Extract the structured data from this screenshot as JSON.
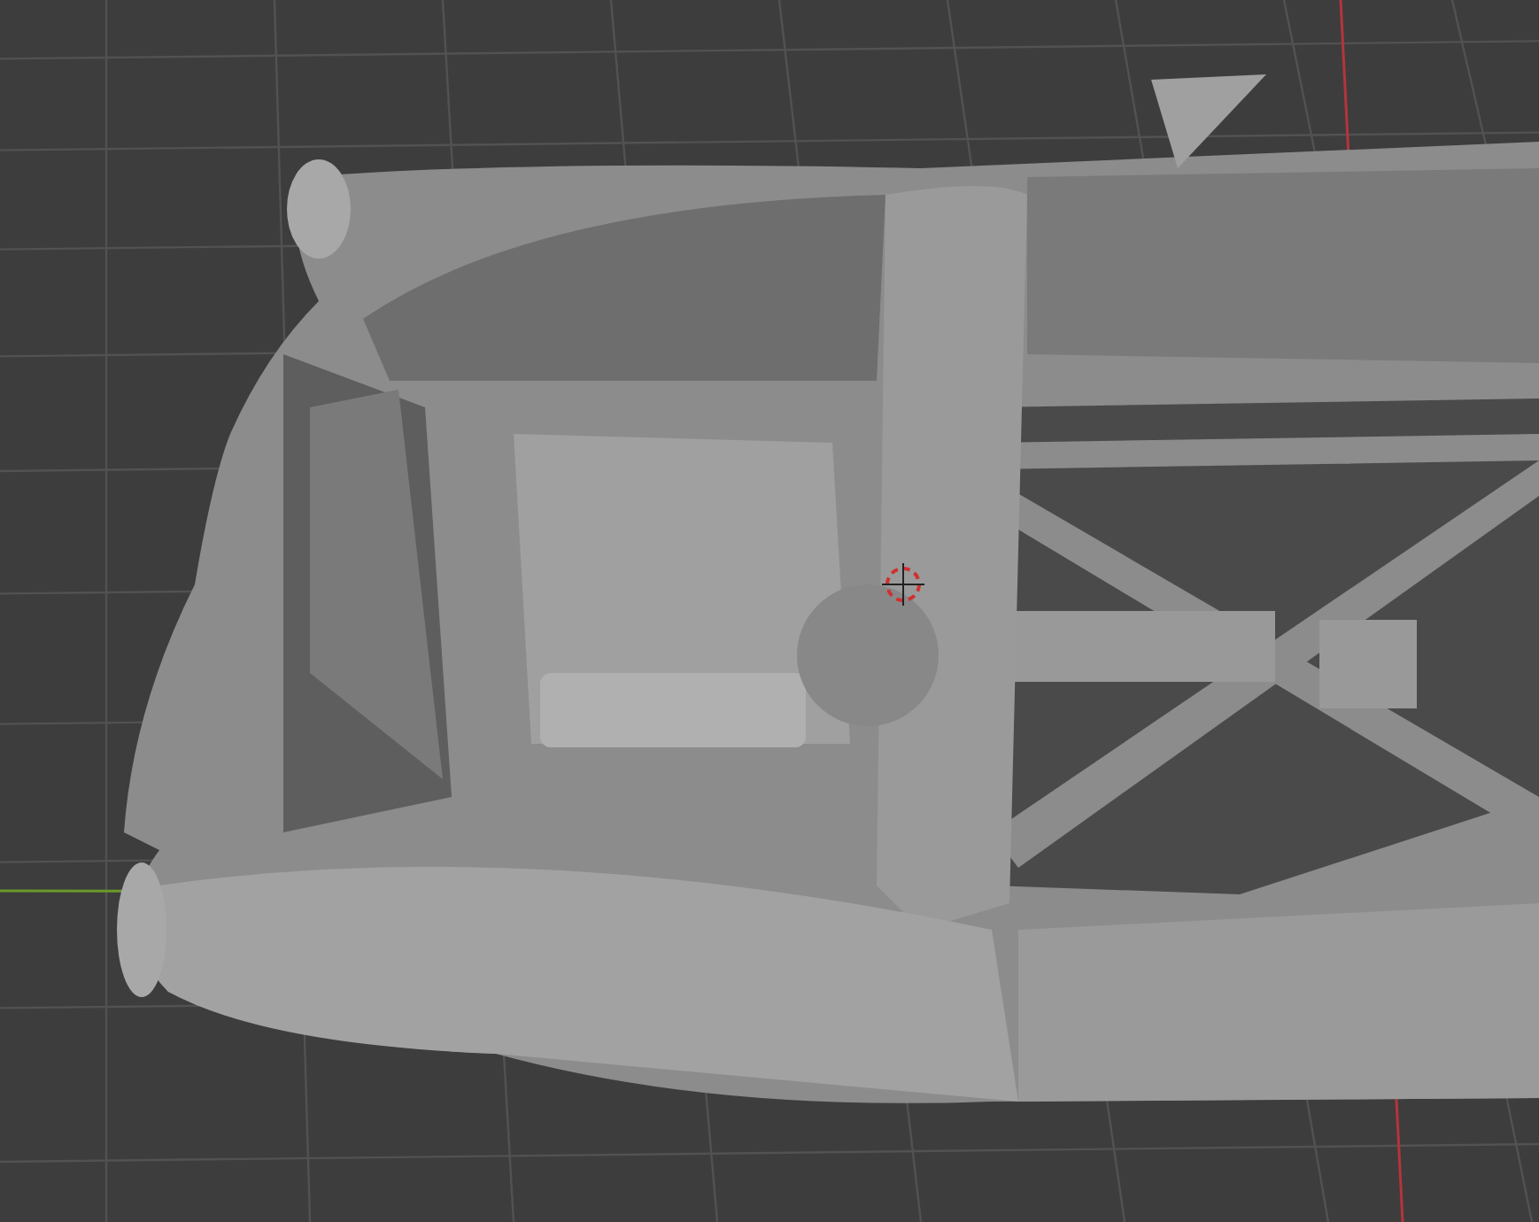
{
  "viewport": {
    "show_grid": true,
    "show_axes": true,
    "show_cursor": true
  }
}
